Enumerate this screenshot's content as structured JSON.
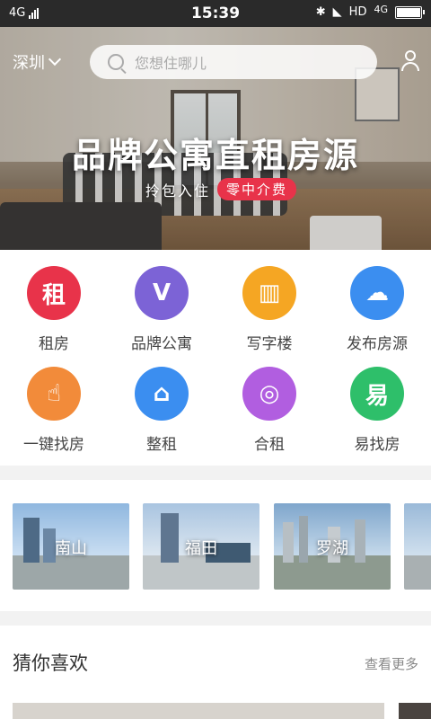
{
  "status_bar": {
    "network_left": "4G",
    "time": "15:39",
    "network_right": "HD",
    "network_right2": "4G"
  },
  "header": {
    "city": "深圳",
    "search_placeholder": "您想住哪儿"
  },
  "banner": {
    "title": "品牌公寓直租房源",
    "subtitle": "拎包入住",
    "badge": "零中介费"
  },
  "categories": [
    {
      "label": "租房",
      "glyph": "租",
      "color": "#e8334a"
    },
    {
      "label": "品牌公寓",
      "glyph": "V",
      "color": "#7c63d6"
    },
    {
      "label": "写字楼",
      "glyph": "▥",
      "color": "#f5a623"
    },
    {
      "label": "发布房源",
      "glyph": "☁",
      "color": "#3b8ef0"
    },
    {
      "label": "一键找房",
      "glyph": "☝",
      "color": "#f28b3a"
    },
    {
      "label": "整租",
      "glyph": "⌂",
      "color": "#3b8ef0"
    },
    {
      "label": "合租",
      "glyph": "◎",
      "color": "#b15ee0"
    },
    {
      "label": "易找房",
      "glyph": "易",
      "color": "#2ebf6a"
    }
  ],
  "districts": [
    {
      "name": "南山"
    },
    {
      "name": "福田"
    },
    {
      "name": "罗湖"
    }
  ],
  "recommend": {
    "title": "猜你喜欢",
    "more": "查看更多"
  }
}
